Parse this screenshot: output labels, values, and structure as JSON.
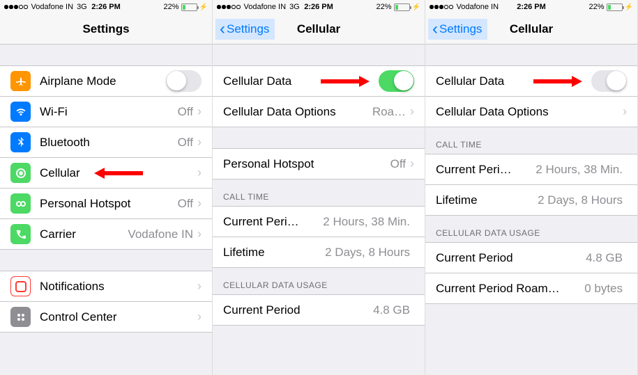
{
  "status": {
    "carrier": "Vodafone IN",
    "network": "3G",
    "time": "2:26 PM",
    "battery": "22%"
  },
  "panel1": {
    "title": "Settings",
    "rows": {
      "airplane": "Airplane Mode",
      "wifi": "Wi-Fi",
      "wifi_val": "Off",
      "bluetooth": "Bluetooth",
      "bluetooth_val": "Off",
      "cellular": "Cellular",
      "hotspot": "Personal Hotspot",
      "hotspot_val": "Off",
      "carrier": "Carrier",
      "carrier_val": "Vodafone IN",
      "notifications": "Notifications",
      "controlcenter": "Control Center"
    }
  },
  "panel2": {
    "back": "Settings",
    "title": "Cellular",
    "rows": {
      "data": "Cellular Data",
      "options": "Cellular Data Options",
      "options_val": "Roa…",
      "hotspot": "Personal Hotspot",
      "hotspot_val": "Off"
    },
    "headers": {
      "calltime": "CALL TIME",
      "usage": "CELLULAR DATA USAGE"
    },
    "calltime": {
      "current_label": "Current Peri…",
      "current_val": "2 Hours, 38 Min.",
      "lifetime_label": "Lifetime",
      "lifetime_val": "2 Days, 8 Hours"
    },
    "usage": {
      "current_label": "Current Period",
      "current_val": "4.8 GB"
    }
  },
  "panel3": {
    "back": "Settings",
    "title": "Cellular",
    "rows": {
      "data": "Cellular Data",
      "options": "Cellular Data Options"
    },
    "headers": {
      "calltime": "CALL TIME",
      "usage": "CELLULAR DATA USAGE"
    },
    "calltime": {
      "current_label": "Current Peri…",
      "current_val": "2 Hours, 38 Min.",
      "lifetime_label": "Lifetime",
      "lifetime_val": "2 Days, 8 Hours"
    },
    "usage": {
      "current_label": "Current Period",
      "current_val": "4.8 GB",
      "roam_label": "Current Period Roam…",
      "roam_val": "0 bytes"
    }
  }
}
